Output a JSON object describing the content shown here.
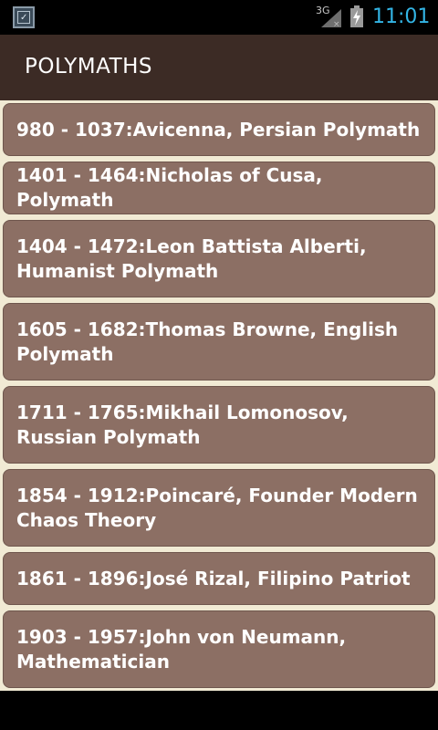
{
  "status_bar": {
    "network": "3G",
    "time": "11:01"
  },
  "action_bar": {
    "title": "POLYMATHS"
  },
  "items": [
    {
      "label": "980 - 1037:Avicenna, Persian Polymath"
    },
    {
      "label": "1401 - 1464:Nicholas of Cusa, Polymath"
    },
    {
      "label": "1404 - 1472:Leon Battista Alberti, Humanist Polymath"
    },
    {
      "label": "1605 - 1682:Thomas Browne, English Polymath"
    },
    {
      "label": "1711 - 1765:Mikhail Lomonosov, Russian Polymath"
    },
    {
      "label": "1854 - 1912:Poincaré, Founder Modern Chaos Theory"
    },
    {
      "label": "1861 - 1896:José Rizal, Filipino Patriot"
    },
    {
      "label": "1903 - 1957:John von Neumann, Mathematician"
    }
  ],
  "colors": {
    "action_bar": "#3c2b25",
    "card": "#8c6f64",
    "card_border": "#f1ead4",
    "clock": "#33b5e5"
  }
}
